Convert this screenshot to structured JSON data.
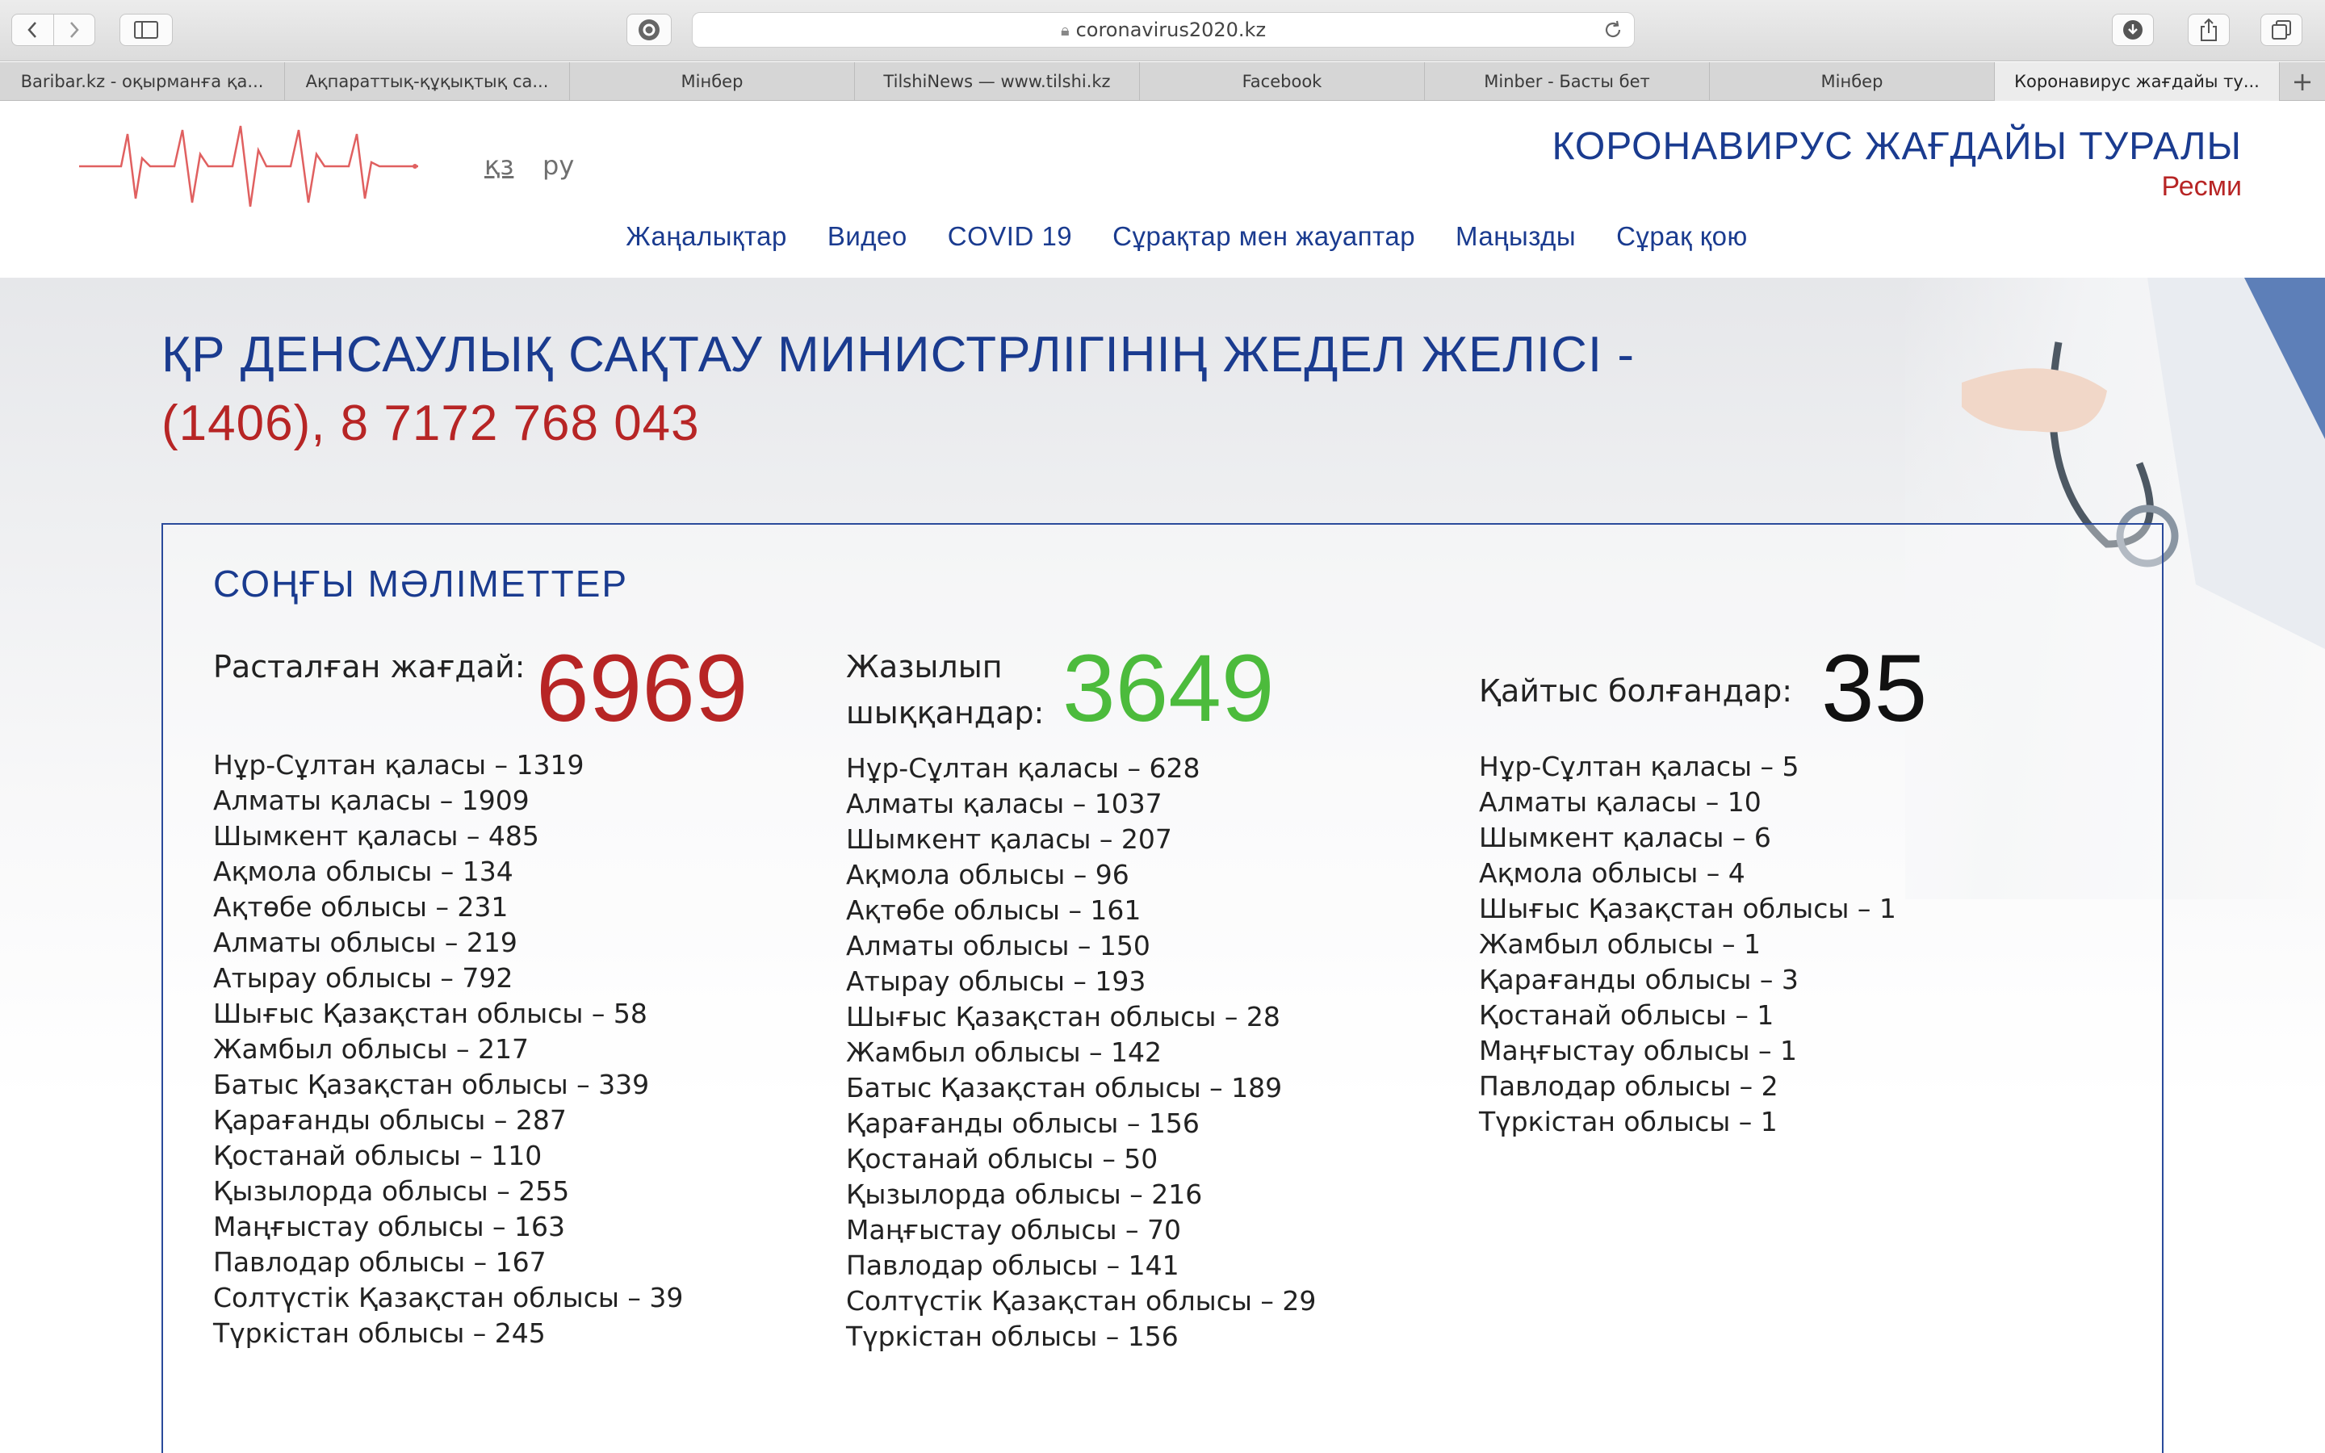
{
  "browser": {
    "url": "coronavirus2020.kz",
    "tabs": [
      "Baribar.kz - оқырманға қа...",
      "Ақпараттық-құқықтық са...",
      "Мінбер",
      "TilshiNews — www.tilshi.kz",
      "Facebook",
      "Minber - Басты бет",
      "Мінбер",
      "Коронавирус жағдайы ту..."
    ],
    "icons": {
      "back": "chevron-left-icon",
      "forward": "chevron-right-icon",
      "sidebar": "sidebar-icon",
      "grammarly": "grammarly-icon",
      "lock": "lock-icon",
      "reload": "reload-icon",
      "download": "download-icon",
      "share": "share-icon",
      "tabs": "tabs-icon",
      "new_tab": "plus-icon"
    }
  },
  "header": {
    "lang_kz": "қз",
    "lang_ru": "ру",
    "title": "КОРОНАВИРУС ЖАҒДАЙЫ ТУРАЛЫ",
    "subtitle": "Ресми",
    "nav": [
      "Жаңалықтар",
      "Видео",
      "COVID 19",
      "Сұрақтар мен жауаптар",
      "Маңызды",
      "Сұрақ қою"
    ]
  },
  "hotline": {
    "line1": "ҚР ДЕНСАУЛЫҚ САҚТАУ МИНИСТРЛІГІНІҢ ЖЕДЕЛ ЖЕЛІСІ -",
    "line2": "(1406), 8 7172 768 043"
  },
  "stats": {
    "title": "СОҢҒЫ МӘЛІМЕТТЕР",
    "confirmed": {
      "label": "Расталған жағдай:",
      "value": "6969",
      "regions": [
        "Нұр-Сұлтан қаласы – 1319",
        "Алматы қаласы – 1909",
        "Шымкент қаласы – 485",
        "Ақмола облысы – 134",
        "Ақтөбе облысы – 231",
        "Алматы облысы – 219",
        "Атырау облысы – 792",
        "Шығыс Қазақстан облысы – 58",
        "Жамбыл облысы – 217",
        "Батыс Қазақстан облысы – 339",
        "Қарағанды облысы – 287",
        "Қостанай облысы – 110",
        "Қызылорда облысы – 255",
        "Маңғыстау облысы – 163",
        "Павлодар облысы – 167",
        "Солтүстік Қазақстан облысы – 39",
        "Түркістан облысы – 245"
      ]
    },
    "recovered": {
      "label_line1": "Жазылып",
      "label_line2": "шыққандар:",
      "value": "3649",
      "regions": [
        "Нұр-Сұлтан қаласы – 628",
        "Алматы қаласы – 1037",
        "Шымкент қаласы – 207",
        "Ақмола облысы – 96",
        "Ақтөбе облысы – 161",
        "Алматы облысы – 150",
        "Атырау облысы – 193",
        "Шығыс Қазақстан облысы – 28",
        "Жамбыл облысы – 142",
        "Батыс Қазақстан облысы – 189",
        "Қарағанды облысы – 156",
        "Қостанай облысы – 50",
        "Қызылорда облысы – 216",
        "Маңғыстау облысы – 70",
        "Павлодар облысы – 141",
        "Солтүстік Қазақстан облысы – 29",
        "Түркістан облысы – 156"
      ]
    },
    "deaths": {
      "label": "Қайтыс болғандар:",
      "value": "35",
      "regions": [
        "Нұр-Сұлтан қаласы – 5",
        "Алматы қаласы – 10",
        "Шымкент қаласы – 6",
        "Ақмола облысы – 4",
        "Шығыс Қазақстан облысы – 1",
        "Жамбыл облысы – 1",
        "Қарағанды облысы – 3",
        "Қостанай облысы – 1",
        "Маңғыстау облысы – 1",
        "Павлодар облысы – 2",
        "Түркістан облысы – 1"
      ]
    }
  },
  "colors": {
    "brand_blue": "#1a3b8f",
    "accent_red": "#b72525",
    "recovered_green": "#4cbb3c",
    "deaths_black": "#111111"
  }
}
